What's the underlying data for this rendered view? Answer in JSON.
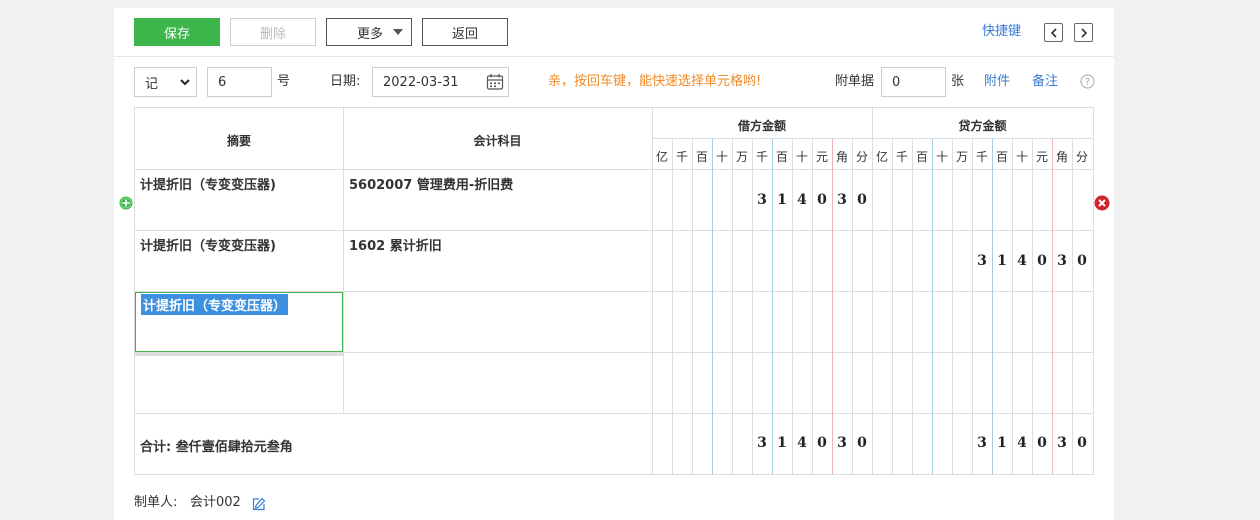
{
  "toolbar": {
    "save_label": "保存",
    "delete_label": "删除",
    "more_label": "更多",
    "back_label": "返回",
    "shortcut_label": "快捷键"
  },
  "voucher": {
    "type": "记",
    "number": "6",
    "number_suffix": "号",
    "date_label": "日期:",
    "date": "2022-03-31",
    "hint": "亲，按回车键，能快速选择单元格哟!",
    "attach_label": "附单据",
    "attach_count": "0",
    "attach_unit": "张",
    "attachment_link": "附件",
    "remark_link": "备注"
  },
  "table": {
    "col_summary": "摘要",
    "col_account": "会计科目",
    "col_debit": "借方金额",
    "col_credit": "贷方金额",
    "units": [
      "亿",
      "千",
      "百",
      "十",
      "万",
      "千",
      "百",
      "十",
      "元",
      "角",
      "分"
    ],
    "rows": [
      {
        "summary": "计提折旧（专变变压器)",
        "account": "5602007 管理费用-折旧费",
        "debit": [
          "3",
          "1",
          "4",
          "0",
          "3",
          "0"
        ],
        "credit": []
      },
      {
        "summary": "计提折旧（专变变压器)",
        "account": "1602 累计折旧",
        "debit": [],
        "credit": [
          "3",
          "1",
          "4",
          "0",
          "3",
          "0"
        ]
      },
      {
        "summary_editing": "计提折旧（专变变压器）",
        "account": ""
      },
      {
        "summary": "",
        "account": ""
      }
    ],
    "total_label": "合计: 叁仟壹佰肆拾元叁角",
    "total_debit": [
      "3",
      "1",
      "4",
      "0",
      "3",
      "0"
    ],
    "total_credit": [
      "3",
      "1",
      "4",
      "0",
      "3",
      "0"
    ]
  },
  "footer": {
    "maker_label": "制单人:",
    "maker": "会计002"
  },
  "colors": {
    "primary": "#3cb64b",
    "hint": "#f08a24",
    "link": "#3a7bd5",
    "selection": "#3d8fe0",
    "delete_icon": "#d0232b",
    "add_icon": "#3cb64b"
  }
}
